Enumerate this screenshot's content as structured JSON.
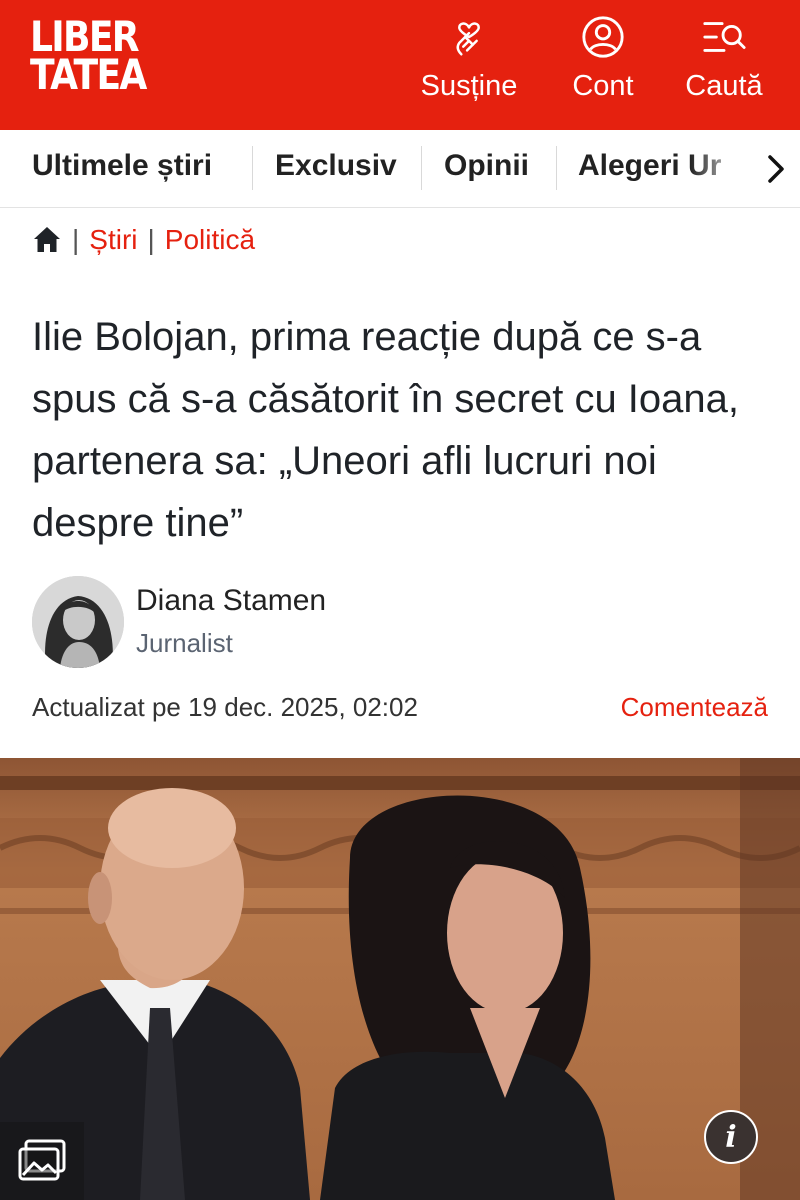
{
  "header": {
    "logo_line1": "LIBER",
    "logo_line2": "TATEA",
    "support_label": "Susține",
    "account_label": "Cont",
    "search_label": "Caută",
    "brand_color": "#e5210f"
  },
  "nav": {
    "items": [
      "Ultimele știri",
      "Exclusiv",
      "Opinii",
      "Alegeri Ur"
    ]
  },
  "breadcrumb": {
    "sep": "|",
    "items": [
      "Știri",
      "Politică"
    ]
  },
  "article": {
    "title": "Ilie Bolojan, prima reacție după ce s-a spus că s-a căsătorit în secret cu Ioana, partenera sa: „Uneori afli lucruri noi despre tine”",
    "author_name": "Diana Stamen",
    "author_role": "Jurnalist",
    "updated": "Actualizat pe 19 dec. 2025, 02:02",
    "comment_label": "Comentează"
  },
  "photo": {
    "info_label": "i"
  },
  "icons": {
    "support": "hand-heart-icon",
    "account": "user-circle-icon",
    "search": "search-menu-icon",
    "home": "home-icon",
    "nav_next": "chevron-right-icon",
    "gallery": "image-gallery-icon",
    "info": "info-icon"
  }
}
